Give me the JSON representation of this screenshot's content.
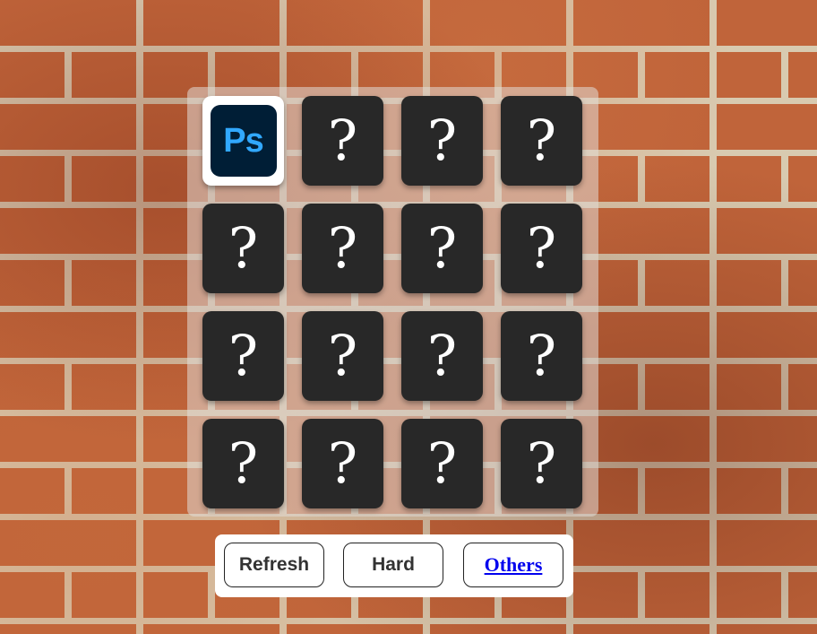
{
  "board": {
    "cards": [
      {
        "state": "revealed",
        "icon": "photoshop-icon",
        "label": "Ps"
      },
      {
        "state": "hidden",
        "label": "?"
      },
      {
        "state": "hidden",
        "label": "?"
      },
      {
        "state": "hidden",
        "label": "?"
      },
      {
        "state": "hidden",
        "label": "?"
      },
      {
        "state": "hidden",
        "label": "?"
      },
      {
        "state": "hidden",
        "label": "?"
      },
      {
        "state": "hidden",
        "label": "?"
      },
      {
        "state": "hidden",
        "label": "?"
      },
      {
        "state": "hidden",
        "label": "?"
      },
      {
        "state": "hidden",
        "label": "?"
      },
      {
        "state": "hidden",
        "label": "?"
      },
      {
        "state": "hidden",
        "label": "?"
      },
      {
        "state": "hidden",
        "label": "?"
      },
      {
        "state": "hidden",
        "label": "?"
      },
      {
        "state": "hidden",
        "label": "?"
      }
    ]
  },
  "controls": {
    "refresh_label": "Refresh",
    "hard_label": "Hard",
    "others_label": "Others"
  },
  "colors": {
    "card_back": "#282828",
    "photoshop_bg": "#001e36",
    "photoshop_fg": "#31a8ff",
    "link": "#0000ee"
  }
}
